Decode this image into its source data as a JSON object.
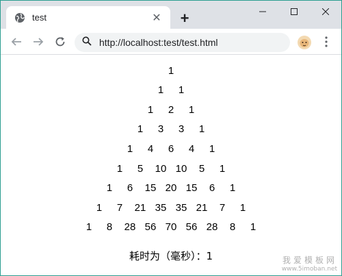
{
  "tab": {
    "title": "test",
    "close": "✕"
  },
  "new_tab_label": "+",
  "address": {
    "url": "http://localhost:test/test.html"
  },
  "pascal_rows": [
    [
      "1"
    ],
    [
      "1",
      "1"
    ],
    [
      "1",
      "2",
      "1"
    ],
    [
      "1",
      "3",
      "3",
      "1"
    ],
    [
      "1",
      "4",
      "6",
      "4",
      "1"
    ],
    [
      "1",
      "5",
      "10",
      "10",
      "5",
      "1"
    ],
    [
      "1",
      "6",
      "15",
      "20",
      "15",
      "6",
      "1"
    ],
    [
      "1",
      "7",
      "21",
      "35",
      "35",
      "21",
      "7",
      "1"
    ],
    [
      "1",
      "8",
      "28",
      "56",
      "70",
      "56",
      "28",
      "8",
      "1"
    ]
  ],
  "timing_text": "耗时为（毫秒）：1",
  "watermark": {
    "line1": "我爱模板网",
    "line2": "www.5imoban.net"
  },
  "colors": {
    "tabstrip": "#dee1e6",
    "omnibox": "#f1f3f4",
    "frame": "#2a9d8f"
  }
}
